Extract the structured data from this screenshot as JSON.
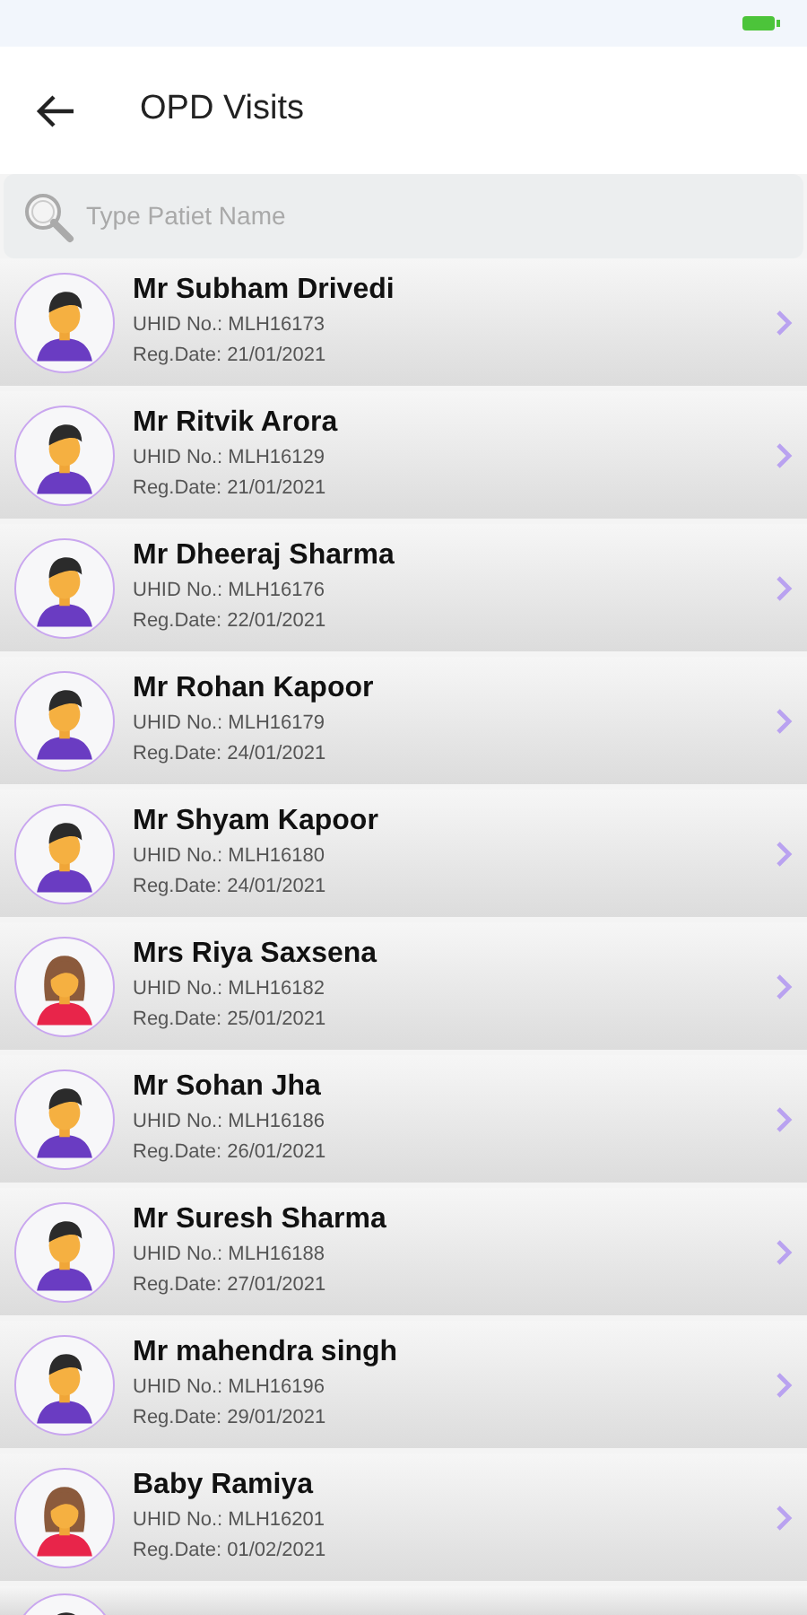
{
  "header": {
    "title": "OPD Visits"
  },
  "search": {
    "placeholder": "Type Patiet Name"
  },
  "patients": [
    {
      "name": "Mr Subham Drivedi",
      "uhid": "UHID No.: MLH16173",
      "reg_date": "Reg.Date: 21/01/2021",
      "kind": "male"
    },
    {
      "name": "Mr Ritvik Arora",
      "uhid": "UHID No.: MLH16129",
      "reg_date": "Reg.Date: 21/01/2021",
      "kind": "male"
    },
    {
      "name": "Mr Dheeraj Sharma",
      "uhid": "UHID No.: MLH16176",
      "reg_date": "Reg.Date: 22/01/2021",
      "kind": "male"
    },
    {
      "name": "Mr Rohan Kapoor",
      "uhid": "UHID No.: MLH16179",
      "reg_date": "Reg.Date: 24/01/2021",
      "kind": "male"
    },
    {
      "name": "Mr Shyam Kapoor",
      "uhid": "UHID No.: MLH16180",
      "reg_date": "Reg.Date: 24/01/2021",
      "kind": "male"
    },
    {
      "name": "Mrs Riya Saxsena",
      "uhid": "UHID No.: MLH16182",
      "reg_date": "Reg.Date: 25/01/2021",
      "kind": "female"
    },
    {
      "name": "Mr Sohan Jha",
      "uhid": "UHID No.: MLH16186",
      "reg_date": "Reg.Date: 26/01/2021",
      "kind": "male"
    },
    {
      "name": "Mr Suresh Sharma",
      "uhid": "UHID No.: MLH16188",
      "reg_date": "Reg.Date: 27/01/2021",
      "kind": "male"
    },
    {
      "name": "Mr mahendra singh",
      "uhid": "UHID No.: MLH16196",
      "reg_date": "Reg.Date: 29/01/2021",
      "kind": "male"
    },
    {
      "name": "Baby Ramiya",
      "uhid": "UHID No.: MLH16201",
      "reg_date": "Reg.Date: 01/02/2021",
      "kind": "female"
    },
    {
      "kind": "male"
    }
  ]
}
